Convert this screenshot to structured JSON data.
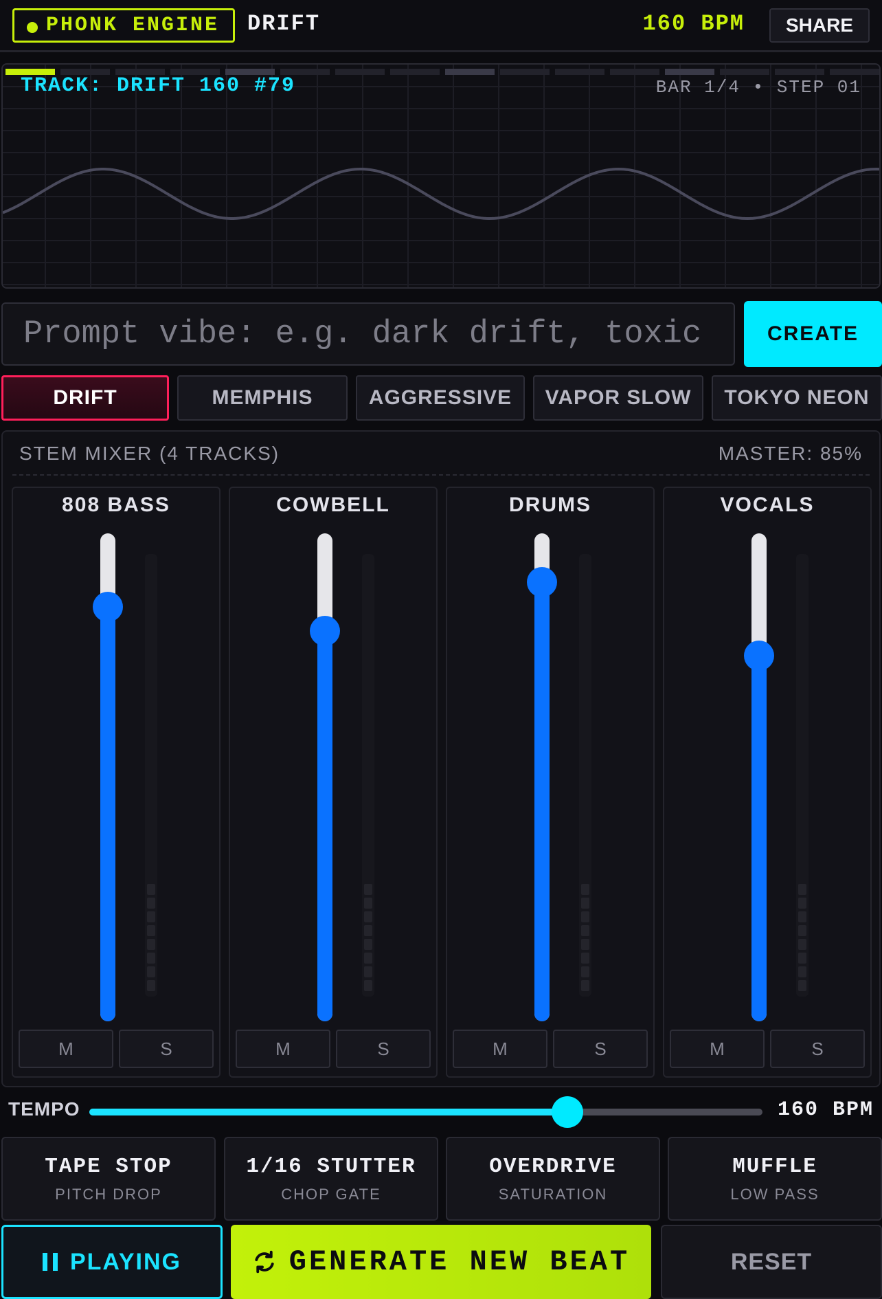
{
  "header": {
    "brand": "PHONK ENGINE",
    "mode": "DRIFT",
    "bpm": "160 BPM",
    "share_label": "SHARE"
  },
  "visualizer": {
    "track": "TRACK: DRIFT 160 #79",
    "position": "BAR 1/4 • STEP 01",
    "active_step": 1,
    "total_steps": 16
  },
  "prompt": {
    "placeholder": "Prompt vibe: e.g. dark drift, toxic",
    "create_label": "CREATE"
  },
  "presets": [
    {
      "label": "DRIFT",
      "active": true
    },
    {
      "label": "MEMPHIS",
      "active": false
    },
    {
      "label": "AGGRESSIVE",
      "active": false
    },
    {
      "label": "VAPOR SLOW",
      "active": false
    },
    {
      "label": "TOKYO NEON",
      "active": false
    }
  ],
  "mixer": {
    "title": "STEM MIXER (4 TRACKS)",
    "master": "MASTER: 85%",
    "channels": [
      {
        "name": "808 BASS",
        "level": 0.85,
        "mute": "M",
        "solo": "S"
      },
      {
        "name": "COWBELL",
        "level": 0.8,
        "mute": "M",
        "solo": "S"
      },
      {
        "name": "DRUMS",
        "level": 0.9,
        "mute": "M",
        "solo": "S"
      },
      {
        "name": "VOCALS",
        "level": 0.75,
        "mute": "M",
        "solo": "S"
      }
    ]
  },
  "tempo": {
    "label": "TEMPO",
    "value": "160 BPM",
    "level": 0.71
  },
  "fx": [
    {
      "name": "TAPE STOP",
      "sub": "PITCH DROP"
    },
    {
      "name": "1/16 STUTTER",
      "sub": "CHOP GATE"
    },
    {
      "name": "OVERDRIVE",
      "sub": "SATURATION"
    },
    {
      "name": "MUFFLE",
      "sub": "LOW PASS"
    }
  ],
  "controls": {
    "play_label": "PLAYING",
    "generate_label": "GENERATE NEW BEAT",
    "reset_label": "RESET"
  },
  "icons": {
    "pause": "pause-icon",
    "refresh": "refresh-icon"
  },
  "colors": {
    "lime": "#c7ef0a",
    "cyan": "#00eaff",
    "blue": "#0a72ff",
    "pink": "#ff1f5a"
  }
}
